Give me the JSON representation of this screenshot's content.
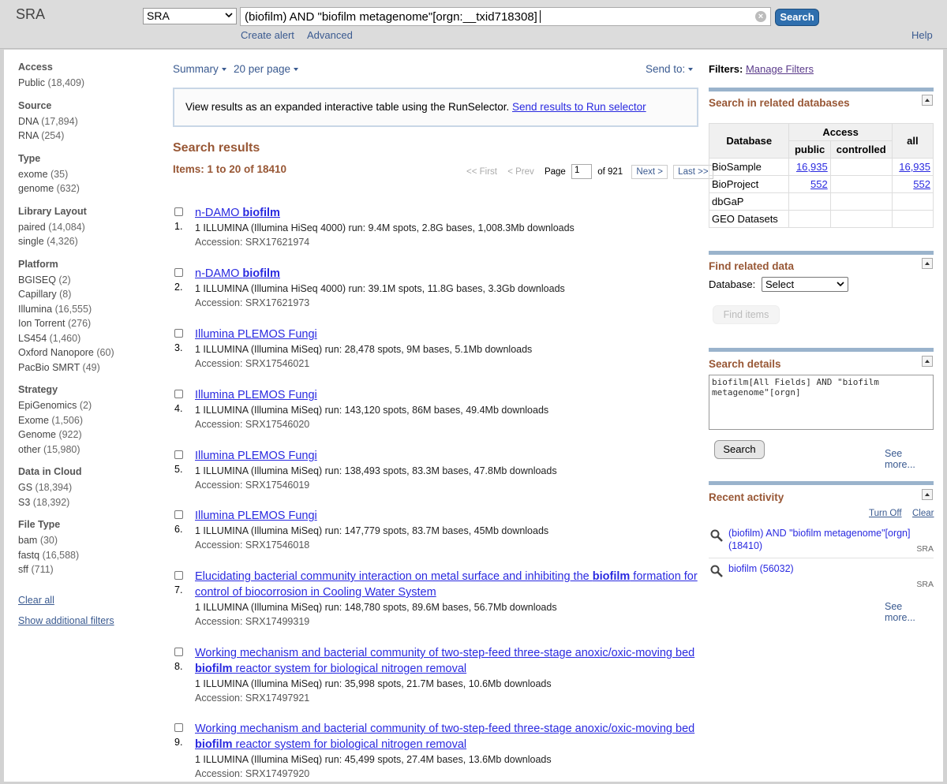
{
  "header": {
    "logo": "SRA",
    "db_select": "SRA",
    "search_query": "(biofilm) AND \"biofilm metagenome\"[orgn:__txid718308]",
    "search_button": "Search",
    "create_alert": "Create alert",
    "advanced": "Advanced",
    "help": "Help"
  },
  "sidebar": {
    "groups": [
      {
        "title": "Access",
        "items": [
          {
            "label": "Public",
            "count": "(18,409)"
          }
        ]
      },
      {
        "title": "Source",
        "items": [
          {
            "label": "DNA",
            "count": "(17,894)"
          },
          {
            "label": "RNA",
            "count": "(254)"
          }
        ]
      },
      {
        "title": "Type",
        "items": [
          {
            "label": "exome",
            "count": "(35)"
          },
          {
            "label": "genome",
            "count": "(632)"
          }
        ]
      },
      {
        "title": "Library Layout",
        "items": [
          {
            "label": "paired",
            "count": "(14,084)"
          },
          {
            "label": "single",
            "count": "(4,326)"
          }
        ]
      },
      {
        "title": "Platform",
        "items": [
          {
            "label": "BGISEQ",
            "count": "(2)"
          },
          {
            "label": "Capillary",
            "count": "(8)"
          },
          {
            "label": "Illumina",
            "count": "(16,555)"
          },
          {
            "label": "Ion Torrent",
            "count": "(276)"
          },
          {
            "label": "LS454",
            "count": "(1,460)"
          },
          {
            "label": "Oxford Nanopore",
            "count": "(60)"
          },
          {
            "label": "PacBio SMRT",
            "count": "(49)"
          }
        ]
      },
      {
        "title": "Strategy",
        "items": [
          {
            "label": "EpiGenomics",
            "count": "(2)"
          },
          {
            "label": "Exome",
            "count": "(1,506)"
          },
          {
            "label": "Genome",
            "count": "(922)"
          },
          {
            "label": "other",
            "count": "(15,980)"
          }
        ]
      },
      {
        "title": "Data in Cloud",
        "items": [
          {
            "label": "GS",
            "count": "(18,394)"
          },
          {
            "label": "S3",
            "count": "(18,392)"
          }
        ]
      },
      {
        "title": "File Type",
        "items": [
          {
            "label": "bam",
            "count": "(30)"
          },
          {
            "label": "fastq",
            "count": "(16,588)"
          },
          {
            "label": "sff",
            "count": "(711)"
          }
        ]
      }
    ],
    "clear_all": "Clear all",
    "show_additional": "Show additional filters"
  },
  "toolbar": {
    "summary": "Summary",
    "per_page": "20 per page",
    "send_to": "Send to:"
  },
  "runselector": {
    "text": "View results as an expanded interactive table using the RunSelector.",
    "link": "Send results to Run selector"
  },
  "results": {
    "title": "Search results",
    "items_count": "Items: 1 to 20 of 18410",
    "pager": {
      "first": "<< First",
      "prev": "< Prev",
      "page_label": "Page",
      "page_value": "1",
      "of_pages": "of 921",
      "next": "Next >",
      "last": "Last >>"
    },
    "list": [
      {
        "num": "1.",
        "pre": "n-DAMO ",
        "bold": "biofilm",
        "post": "",
        "desc": "1 ILLUMINA (Illumina HiSeq 4000) run: 9.4M spots, 2.8G bases, 1,008.3Mb downloads",
        "acc": "Accession: SRX17621974"
      },
      {
        "num": "2.",
        "pre": "n-DAMO ",
        "bold": "biofilm",
        "post": "",
        "desc": "1 ILLUMINA (Illumina HiSeq 4000) run: 39.1M spots, 11.8G bases, 3.3Gb downloads",
        "acc": "Accession: SRX17621973"
      },
      {
        "num": "3.",
        "pre": "Illumina PLEMOS Fungi",
        "bold": "",
        "post": "",
        "desc": "1 ILLUMINA (Illumina MiSeq) run: 28,478 spots, 9M bases, 5.1Mb downloads",
        "acc": "Accession: SRX17546021"
      },
      {
        "num": "4.",
        "pre": "Illumina PLEMOS Fungi",
        "bold": "",
        "post": "",
        "desc": "1 ILLUMINA (Illumina MiSeq) run: 143,120 spots, 86M bases, 49.4Mb downloads",
        "acc": "Accession: SRX17546020"
      },
      {
        "num": "5.",
        "pre": "Illumina PLEMOS Fungi",
        "bold": "",
        "post": "",
        "desc": "1 ILLUMINA (Illumina MiSeq) run: 138,493 spots, 83.3M bases, 47.8Mb downloads",
        "acc": "Accession: SRX17546019"
      },
      {
        "num": "6.",
        "pre": "Illumina PLEMOS Fungi",
        "bold": "",
        "post": "",
        "desc": "1 ILLUMINA (Illumina MiSeq) run: 147,779 spots, 83.7M bases, 45Mb downloads",
        "acc": "Accession: SRX17546018"
      },
      {
        "num": "7.",
        "pre": "Elucidating bacterial community interaction on metal surface and inhibiting the ",
        "bold": "biofilm",
        "post": " formation for control of biocorrosion in Cooling Water System",
        "desc": "1 ILLUMINA (Illumina MiSeq) run: 148,780 spots, 89.6M bases, 56.7Mb downloads",
        "acc": "Accession: SRX17499319"
      },
      {
        "num": "8.",
        "pre": "Working mechanism and bacterial community of two-step-feed three-stage anoxic/oxic-moving bed ",
        "bold": "biofilm",
        "post": " reactor system for biological nitrogen removal",
        "desc": "1 ILLUMINA (Illumina MiSeq) run: 35,998 spots, 21.7M bases, 10.6Mb downloads",
        "acc": "Accession: SRX17497921"
      },
      {
        "num": "9.",
        "pre": "Working mechanism and bacterial community of two-step-feed three-stage anoxic/oxic-moving bed ",
        "bold": "biofilm",
        "post": " reactor system for biological nitrogen removal",
        "desc": "1 ILLUMINA (Illumina MiSeq) run: 45,499 spots, 27.4M bases, 13.6Mb downloads",
        "acc": "Accession: SRX17497920"
      }
    ]
  },
  "right": {
    "filters_label": "Filters:",
    "manage_filters": "Manage Filters",
    "related_title": "Search in related databases",
    "table": {
      "h_database": "Database",
      "h_access": "Access",
      "h_public": "public",
      "h_controlled": "controlled",
      "h_all": "all",
      "rows": [
        {
          "db": "BioSample",
          "public": "16,935",
          "controlled": "",
          "all": "16,935"
        },
        {
          "db": "BioProject",
          "public": "552",
          "controlled": "",
          "all": "552"
        },
        {
          "db": "dbGaP",
          "public": "",
          "controlled": "",
          "all": ""
        },
        {
          "db": "GEO Datasets",
          "public": "",
          "controlled": "",
          "all": ""
        }
      ]
    },
    "find_title": "Find related data",
    "database_label": "Database:",
    "database_select": "Select",
    "find_items": "Find items",
    "details_title": "Search details",
    "details_text": "biofilm[All Fields] AND \"biofilm metagenome\"[orgn]",
    "details_search": "Search",
    "see_more": "See more...",
    "activity_title": "Recent activity",
    "turn_off": "Turn Off",
    "clear": "Clear",
    "activity": [
      {
        "text": "(biofilm) AND \"biofilm metagenome\"[orgn] (18410)",
        "db": "SRA"
      },
      {
        "text": "biofilm (56032)",
        "db": "SRA"
      }
    ],
    "see_more2": "See more..."
  },
  "colors": {
    "accent_brown": "#985735",
    "link_blue": "#2a2ae0",
    "search_button": "#2f6fae",
    "portlet_bar": "#9ab3cc"
  }
}
